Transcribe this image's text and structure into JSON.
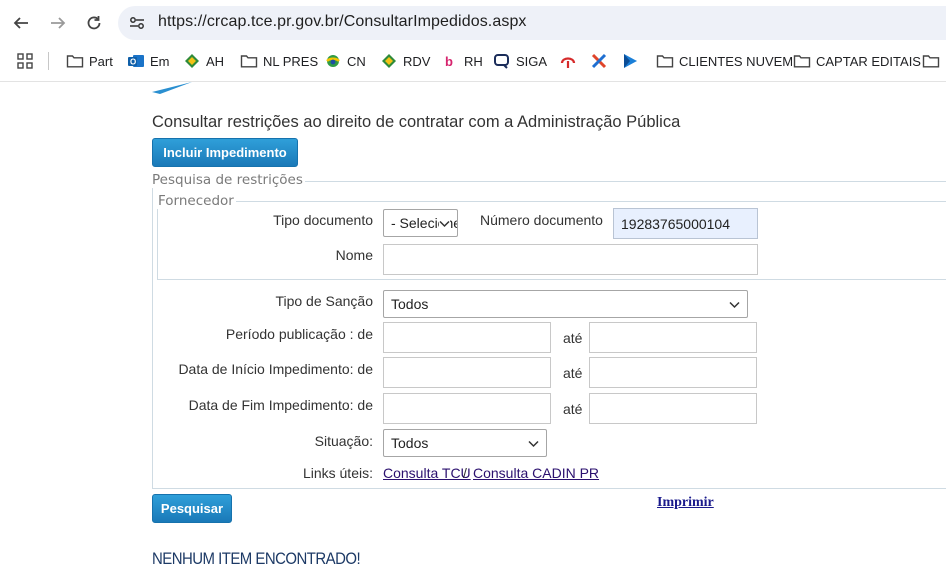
{
  "browser": {
    "url": "https://crcap.tce.pr.gov.br/ConsultarImpedidos.aspx",
    "bookmarks": [
      {
        "label": "Part",
        "icon": "folder-icon"
      },
      {
        "label": "Em",
        "icon": "outlook-icon"
      },
      {
        "label": "AH",
        "icon": "diamond-green-icon"
      },
      {
        "label": "NL PRES",
        "icon": "folder-icon"
      },
      {
        "label": "CN",
        "icon": "globe-flag-icon"
      },
      {
        "label": "RDV",
        "icon": "diamond-green-icon"
      },
      {
        "label": "RH",
        "icon": "b-logo-icon"
      },
      {
        "label": "SIGA",
        "icon": "chat-bubble-icon"
      },
      {
        "label": "",
        "icon": "red-logo-icon"
      },
      {
        "label": "",
        "icon": "x-logo-icon"
      },
      {
        "label": "",
        "icon": "blue-arrow-icon"
      },
      {
        "label": "CLIENTES NUVEM",
        "icon": "folder-icon"
      },
      {
        "label": "CAPTAR EDITAIS",
        "icon": "folder-icon"
      },
      {
        "label": "",
        "icon": "folder-icon"
      }
    ]
  },
  "page": {
    "title": "Consultar restrições ao direito de contratar com a Administração Pública",
    "incluir_label": "Incluir Impedimento",
    "search_legend": "Pesquisa de restrições",
    "fornecedor_legend": "Fornecedor",
    "tipo_documento_label": "Tipo documento",
    "tipo_documento_value": "- Selecione -",
    "numero_documento_label": "Número documento",
    "numero_documento_value": "19283765000104",
    "nome_label": "Nome",
    "nome_value": "",
    "tipo_sancao_label": "Tipo de Sanção",
    "tipo_sancao_value": "Todos",
    "periodo_label": "Período publicação : de",
    "inicio_label": "Data de Início Impedimento: de",
    "fim_label": "Data de Fim Impedimento: de",
    "ate_label": "até",
    "situacao_label": "Situação:",
    "situacao_value": "Todos",
    "links_label": "Links úteis:",
    "link_tcu": "Consulta TCU",
    "link_sep": "/",
    "link_cadin": "Consulta CADIN PR",
    "pesquisar_label": "Pesquisar",
    "imprimir_label": "Imprimir",
    "no_items_text": "NENHUM ITEM ENCONTRADO!"
  },
  "colors": {
    "button_blue": "#2288c8",
    "link_purple": "#2a0f6e",
    "heading_navy": "#1d3a66"
  }
}
